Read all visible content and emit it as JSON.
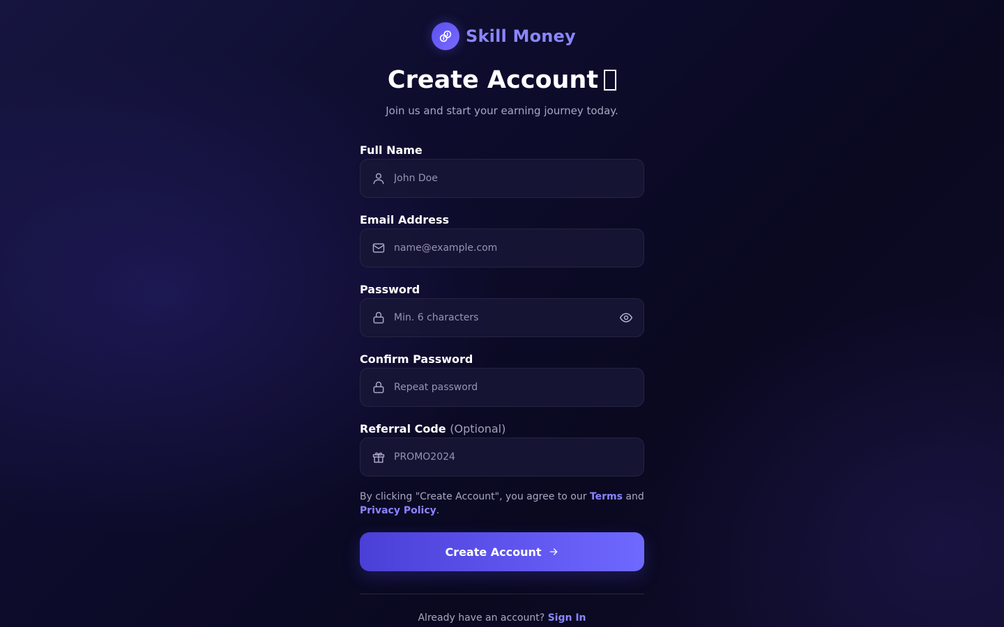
{
  "brand": {
    "name": "Skill Money",
    "logo_icon": "coins-icon"
  },
  "header": {
    "title": "Create Account",
    "title_emoji": "missing-glyph",
    "subtitle": "Join us and start your earning journey today."
  },
  "form": {
    "full_name": {
      "label": "Full Name",
      "placeholder": "John Doe",
      "value": "",
      "icon": "user-icon"
    },
    "email": {
      "label": "Email Address",
      "placeholder": "name@example.com",
      "value": "",
      "icon": "mail-icon"
    },
    "password": {
      "label": "Password",
      "placeholder": "Min. 6 characters",
      "value": "",
      "icon": "lock-icon",
      "toggle_icon": "eye-icon"
    },
    "confirm_password": {
      "label": "Confirm Password",
      "placeholder": "Repeat password",
      "value": "",
      "icon": "lock-icon"
    },
    "referral_code": {
      "label": "Referral Code",
      "optional_label": "(Optional)",
      "placeholder": "PROMO2024",
      "value": "",
      "icon": "gift-icon"
    }
  },
  "terms": {
    "prefix": "By clicking \"Create Account\", you agree to our ",
    "terms_link": "Terms",
    "middle": " and ",
    "privacy_link": "Privacy Policy",
    "suffix": "."
  },
  "submit": {
    "label": "Create Account",
    "icon": "arrow-right-icon"
  },
  "signin": {
    "prompt": "Already have an account? ",
    "link": "Sign In"
  },
  "colors": {
    "accent": "#8b85ff",
    "button_start": "#4a3fd6",
    "button_end": "#6f69ff",
    "background": "#0d0c2c",
    "muted_text": "#a9a6c4"
  }
}
